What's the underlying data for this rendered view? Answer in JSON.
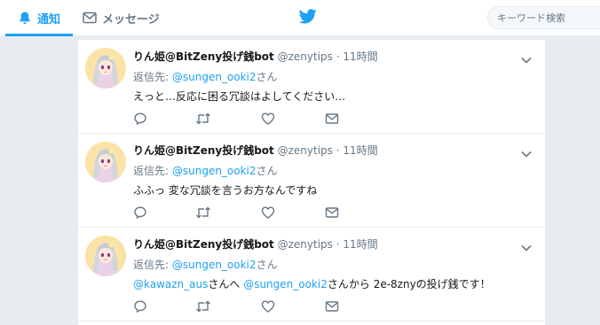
{
  "nav": {
    "notifications": "通知",
    "messages": "メッセージ",
    "search_placeholder": "キーワード検索"
  },
  "colors": {
    "accent": "#1da1f2",
    "background": "#e6ecf0",
    "muted": "#657786"
  },
  "tweets": [
    {
      "fullname": "りん姫@BitZeny投げ銭bot",
      "username": "@zenytips",
      "dot": "·",
      "time": "11時間",
      "reply_prefix": "返信先: ",
      "reply_mention": "@sungen_ooki2",
      "reply_suffix": "さん",
      "text": "えっと…反応に困る冗談はよしてください…"
    },
    {
      "fullname": "りん姫@BitZeny投げ銭bot",
      "username": "@zenytips",
      "dot": "·",
      "time": "11時間",
      "reply_prefix": "返信先: ",
      "reply_mention": "@sungen_ooki2",
      "reply_suffix": "さん",
      "text": "ふふっ 変な冗談を言うお方なんですね"
    },
    {
      "fullname": "りん姫@BitZeny投げ銭bot",
      "username": "@zenytips",
      "dot": "·",
      "time": "11時間",
      "reply_prefix": "返信先: ",
      "reply_mention": "@sungen_ooki2",
      "reply_suffix": "さん",
      "text_mention1": "@kawazn_aus",
      "text_part1": "さんへ ",
      "text_mention2": "@sungen_ooki2",
      "text_part2": "さんから 2e-8znyの投げ銭です！"
    }
  ],
  "icons": [
    "bell-icon",
    "envelope-icon",
    "twitter-bird-icon",
    "chevron-down-icon",
    "reply-icon",
    "retweet-icon",
    "like-icon",
    "dm-icon"
  ]
}
